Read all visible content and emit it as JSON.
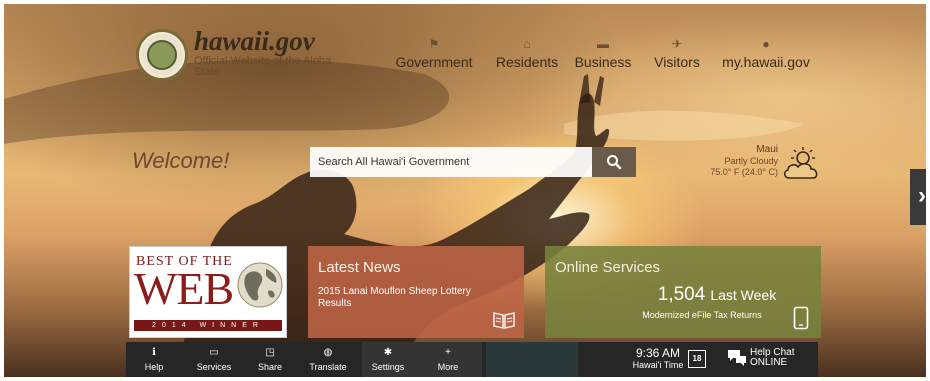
{
  "header": {
    "site_name": "hawaii.gov",
    "site_subtitle": "Official Website of the Aloha State",
    "nav": [
      {
        "label": "Government",
        "icon": "flag-icon"
      },
      {
        "label": "Residents",
        "icon": "residents-icon"
      },
      {
        "label": "Business",
        "icon": "briefcase-icon"
      },
      {
        "label": "Visitors",
        "icon": "airplane-icon"
      },
      {
        "label": "my.hawaii.gov",
        "icon": "user-icon"
      }
    ]
  },
  "hero": {
    "welcome": "Welcome!",
    "search_placeholder": "Search All Hawai'i Government"
  },
  "weather": {
    "location": "Maui",
    "condition": "Partly Cloudy",
    "temperature": "75.0° F (24.0° C)",
    "icon": "partly-cloudy-icon"
  },
  "tiles": {
    "award": {
      "line1": "BEST OF THE",
      "line2": "WEB",
      "line3": "2014 WINNER"
    },
    "news": {
      "title": "Latest News",
      "item": "2015 Lanai Mouflon Sheep Lottery Results"
    },
    "services": {
      "title": "Online Services",
      "count": "1,504",
      "period": "Last Week",
      "description": "Modernized eFile Tax Returns"
    }
  },
  "bottom_bar": {
    "items": [
      {
        "label": "Help",
        "icon": "info-icon"
      },
      {
        "label": "Services",
        "icon": "laptop-icon"
      },
      {
        "label": "Share",
        "icon": "share-icon"
      },
      {
        "label": "Translate",
        "icon": "globe-icon"
      },
      {
        "label": "Settings",
        "icon": "gear-icon"
      },
      {
        "label": "More",
        "icon": "plus-icon"
      }
    ],
    "time": "9:36 AM",
    "time_label": "Hawai'i Time",
    "calendar_day": "18",
    "chat_label": "Help Chat",
    "chat_status": "ONLINE"
  },
  "colors": {
    "news_tile": "#be6446",
    "services_tile": "#78823c",
    "bottom_bar": "#262626",
    "award_red": "#8a1c1c"
  }
}
